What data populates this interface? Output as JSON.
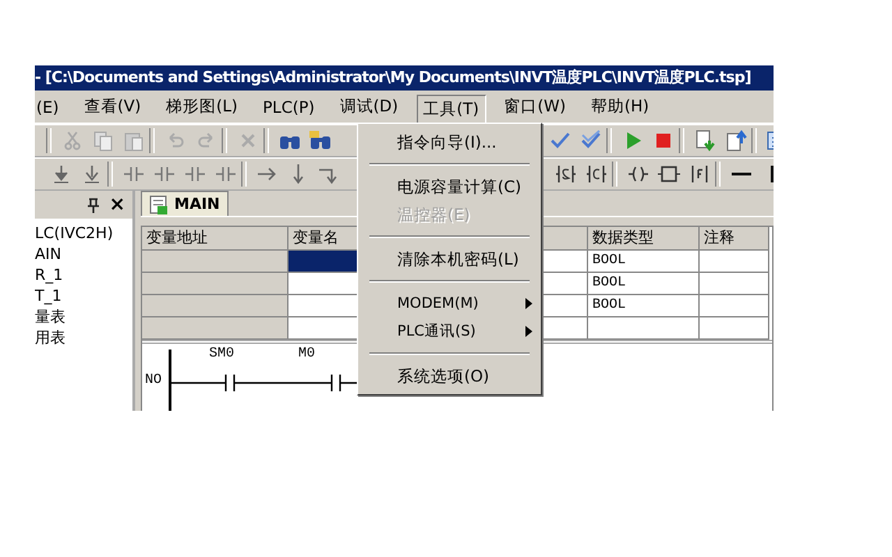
{
  "window": {
    "title": "- [C:\\Documents and Settings\\Administrator\\My Documents\\INVT温度PLC\\INVT温度PLC.tsp]"
  },
  "menu_bar": [
    {
      "label": "(E)",
      "selected": false
    },
    {
      "label": "查看(V)",
      "selected": false
    },
    {
      "label": "梯形图(L)",
      "selected": false
    },
    {
      "label": "PLC(P)",
      "selected": false
    },
    {
      "label": "调试(D)",
      "selected": false
    },
    {
      "label": "工具(T)",
      "selected": true
    },
    {
      "label": "窗口(W)",
      "selected": false
    },
    {
      "label": "帮助(H)",
      "selected": false
    }
  ],
  "project_panel": {
    "close": "×",
    "items": [
      "LC(IVC2H)",
      "AIN",
      "R_1",
      "T_1",
      "量表",
      "用表"
    ]
  },
  "editor": {
    "tab": "MAIN",
    "table": {
      "columns": [
        "变量地址",
        "变量名",
        "数据类型",
        "注释"
      ],
      "rows": [
        {
          "data_type": "BOOL",
          "selected": true
        },
        {
          "data_type": "BOOL",
          "selected": false
        },
        {
          "data_type": "BOOL",
          "selected": false
        },
        {
          "selected": false
        }
      ]
    },
    "ladder": {
      "rung_label": "NO",
      "contacts": [
        "SM0",
        "M0"
      ]
    }
  },
  "dropdown_menu": [
    {
      "kind": "item",
      "label": "指令向导(I)...",
      "disabled": false
    },
    {
      "kind": "separator"
    },
    {
      "kind": "item",
      "label": "电源容量计算(C)",
      "disabled": false
    },
    {
      "kind": "item",
      "label": "温控器(E)",
      "disabled": true
    },
    {
      "kind": "separator"
    },
    {
      "kind": "item",
      "label": "清除本机密码(L)",
      "disabled": false
    },
    {
      "kind": "separator"
    },
    {
      "kind": "submenu",
      "label": "MODEM(M)",
      "disabled": false
    },
    {
      "kind": "submenu",
      "label": "PLC通讯(S)",
      "disabled": false
    },
    {
      "kind": "separator"
    },
    {
      "kind": "item",
      "label": "系统选项(O)",
      "disabled": false
    }
  ]
}
